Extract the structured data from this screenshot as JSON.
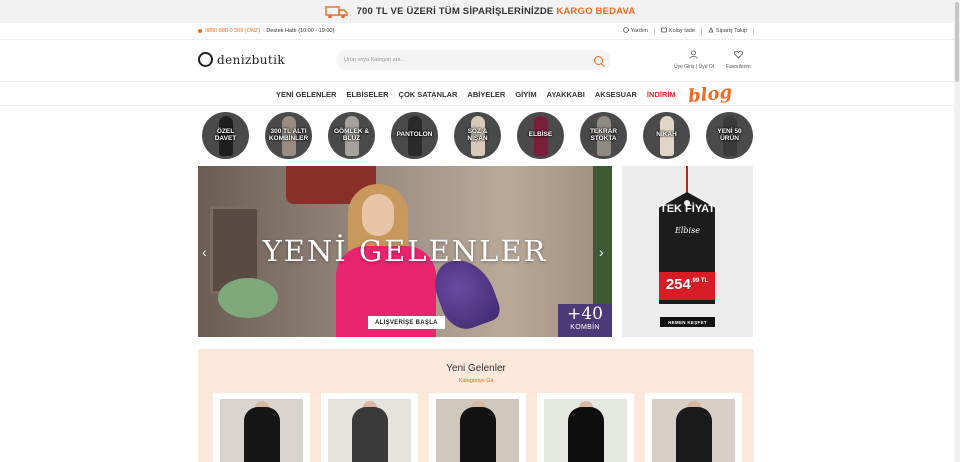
{
  "promo": {
    "text_main": "700 TL VE ÜZERİ TÜM SİPARİŞLERİNİZDE",
    "text_highlight": "KARGO BEDAVA",
    "accent_color": "#f26a21",
    "icon": "truck-icon"
  },
  "infobar": {
    "phone": "0850 888 0 309 (ÖNZ)",
    "support": " - Destek Hattı (10:00 - 19:00)",
    "links": [
      {
        "label": "Yardım",
        "icon": "help-icon"
      },
      {
        "label": "Kolay İade",
        "icon": "return-icon"
      },
      {
        "label": "Sipariş Takip",
        "icon": "order-track-icon"
      }
    ]
  },
  "header": {
    "logo_text": "denizbutik",
    "search_placeholder": "Ürün veya Kategori ara...",
    "account_label": "Üye Giriş | Üye Ol",
    "favorites_label": "Favorilerim"
  },
  "nav": {
    "items": [
      "YENİ GELENLER",
      "ELBİSELER",
      "ÇOK SATANLAR",
      "ABİYELER",
      "GİYİM",
      "AYAKKABI",
      "AKSESUAR"
    ],
    "sale": "İNDİRİM",
    "blog": "blog"
  },
  "categories": [
    {
      "label": "ÖZEL DAVET",
      "color": "#1f1f1f"
    },
    {
      "label": "300 TL ALTI KOMBİNLER",
      "color": "#9a8c80"
    },
    {
      "label": "GÖMLEK & BLUZ",
      "color": "#a8a29c"
    },
    {
      "label": "PANTOLON",
      "color": "#2a2a2a"
    },
    {
      "label": "SÖZ & NİŞAN",
      "color": "#d8c9b8"
    },
    {
      "label": "ELBİSE",
      "color": "#7a1f3a"
    },
    {
      "label": "TEKRAR STOKTA",
      "color": "#8f8a84"
    },
    {
      "label": "NİKAH",
      "color": "#e0d6c8"
    },
    {
      "label": "YENİ 50 ÜRÜN",
      "color": "#3a3a3a"
    }
  ],
  "hero": {
    "title": "YENİ GELENLER",
    "cta": "ALIŞVERİŞE BAŞLA",
    "combo_number": "+40",
    "combo_label": "KOMBİN",
    "prev": "‹",
    "next": "›"
  },
  "side_promo": {
    "title": "TEK FİYAT",
    "script": "Elbise",
    "price_big": "254",
    "price_small": ",99 TL",
    "button": "HEMEN KEŞFET"
  },
  "new_arrivals": {
    "title": "Yeni Gelenler",
    "subtitle": "Kategoriye Git",
    "products": [
      {
        "color": "#161616",
        "bg": "#d9d4cf"
      },
      {
        "color": "#3a3a3a",
        "bg": "#e6e3df"
      },
      {
        "color": "#121212",
        "bg": "#cfc6bc"
      },
      {
        "color": "#0e0e0e",
        "bg": "#e4e8df"
      },
      {
        "color": "#1a1a1a",
        "bg": "#d8cfc6"
      }
    ]
  }
}
